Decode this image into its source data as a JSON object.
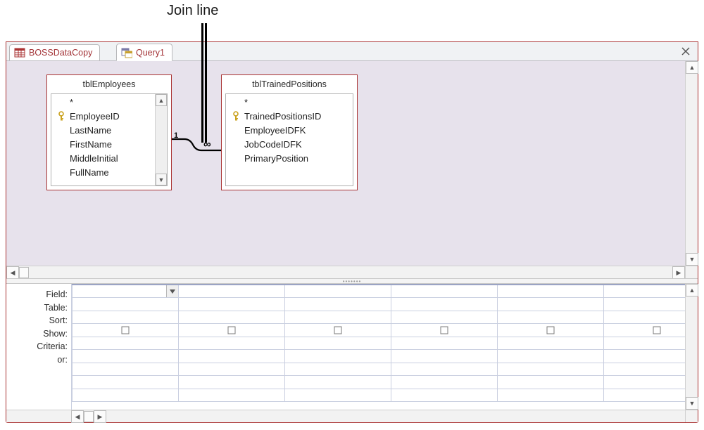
{
  "annotation": {
    "label": "Join line"
  },
  "tabs": [
    {
      "label": "BOSSDataCopy",
      "icon": "datasheet-icon"
    },
    {
      "label": "Query1",
      "icon": "query-icon"
    }
  ],
  "design": {
    "tables": [
      {
        "title": "tblEmployees",
        "fields": [
          "*",
          "EmployeeID",
          "LastName",
          "FirstName",
          "MiddleInitial",
          "FullName"
        ],
        "keyIndex": 1,
        "hasScroll": true
      },
      {
        "title": "tblTrainedPositions",
        "fields": [
          "*",
          "TrainedPositionsID",
          "EmployeeIDFK",
          "JobCodeIDFK",
          "PrimaryPosition"
        ],
        "keyIndex": 1,
        "hasScroll": false
      }
    ],
    "join": {
      "left": "1",
      "right": "∞"
    }
  },
  "grid": {
    "rowLabels": [
      "Field:",
      "Table:",
      "Sort:",
      "Show:",
      "Criteria:",
      "or:"
    ],
    "columns": 6,
    "dropdownCell": {
      "row": 0,
      "col": 0
    },
    "checkboxRow": 3
  }
}
